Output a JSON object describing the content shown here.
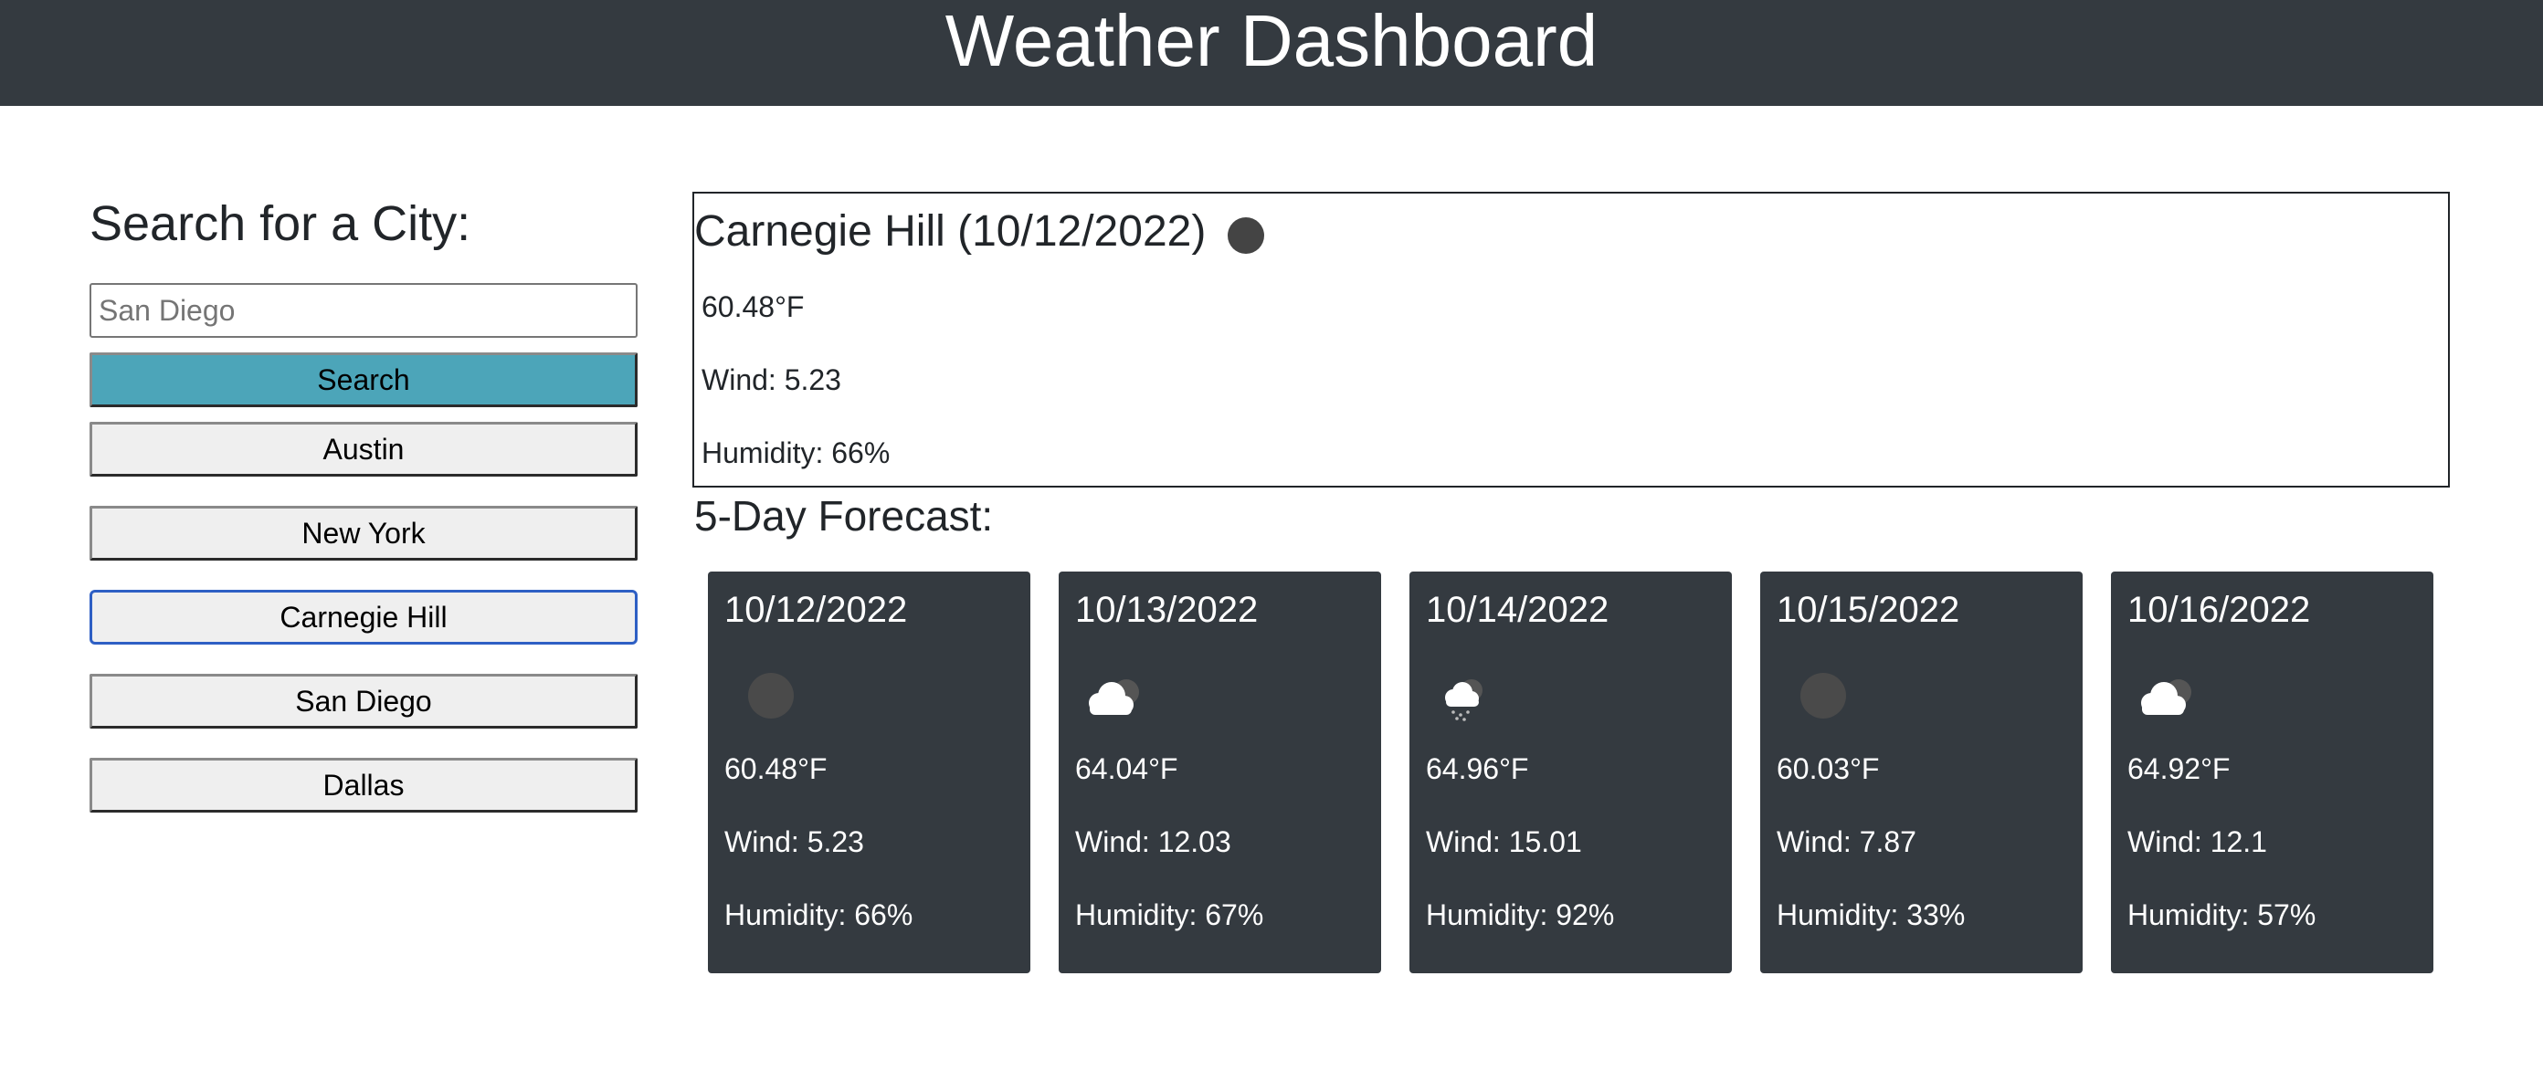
{
  "header": {
    "title": "Weather Dashboard"
  },
  "search": {
    "heading": "Search for a City:",
    "input_value": "",
    "placeholder": "San Diego",
    "button_label": "Search"
  },
  "history": [
    {
      "label": "Austin"
    },
    {
      "label": "New York"
    },
    {
      "label": "Carnegie Hill",
      "active": true
    },
    {
      "label": "San Diego"
    },
    {
      "label": "Dallas"
    }
  ],
  "current": {
    "title": "Carnegie Hill (10/12/2022)",
    "icon": "clear-night-icon",
    "temp": "60.48°F",
    "wind": "Wind: 5.23",
    "humidity": "Humidity: 66%"
  },
  "forecast": {
    "title": "5-Day Forecast:",
    "days": [
      {
        "date": "10/12/2022",
        "icon": "clear-night-icon",
        "temp": "60.48°F",
        "wind": "Wind: 5.23",
        "humidity": "Humidity: 66%"
      },
      {
        "date": "10/13/2022",
        "icon": "cloudy-icon",
        "temp": "64.04°F",
        "wind": "Wind: 12.03",
        "humidity": "Humidity: 67%"
      },
      {
        "date": "10/14/2022",
        "icon": "rain-icon",
        "temp": "64.96°F",
        "wind": "Wind: 15.01",
        "humidity": "Humidity: 92%"
      },
      {
        "date": "10/15/2022",
        "icon": "clear-night-icon",
        "temp": "60.03°F",
        "wind": "Wind: 7.87",
        "humidity": "Humidity: 33%"
      },
      {
        "date": "10/16/2022",
        "icon": "cloudy-icon",
        "temp": "64.92°F",
        "wind": "Wind: 12.1",
        "humidity": "Humidity: 57%"
      }
    ]
  },
  "colors": {
    "header_bg": "#343a40",
    "search_button": "#4ca5b9",
    "history_button": "#efefef",
    "active_border": "#2e5fc4",
    "card_bg": "#343a40"
  }
}
